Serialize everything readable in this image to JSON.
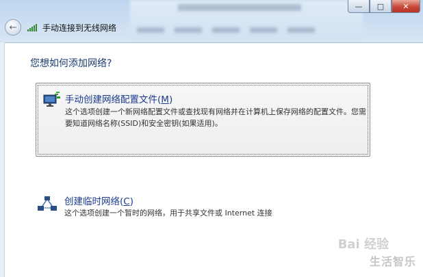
{
  "window": {
    "title": "手动连接到无线网络",
    "controls": [
      "—",
      "□",
      "✕"
    ]
  },
  "heading": "您想如何添加网络?",
  "options": [
    {
      "title": "手动创建网络配置文件(M)",
      "title_main": "手动创建网络配置文件(",
      "title_key": "M",
      "title_end": ")",
      "description": "这个选项创建一个新网络配置文件或查找现有网络并在计算机上保存网络的配置文件。您需要知道网络名称(SSID)和安全密钥(如果适用)。",
      "icon": "wireless-monitor-icon"
    },
    {
      "title": "创建临时网络(C)",
      "title_main": "创建临时网络(",
      "title_key": "C",
      "title_end": ")",
      "description": "这个选项创建一个暂时的网络，用于共享文件或 Internet 连接",
      "icon": "adhoc-network-icon"
    }
  ],
  "watermark": {
    "line1": "Bai 经验",
    "line2": "生活智乐"
  }
}
